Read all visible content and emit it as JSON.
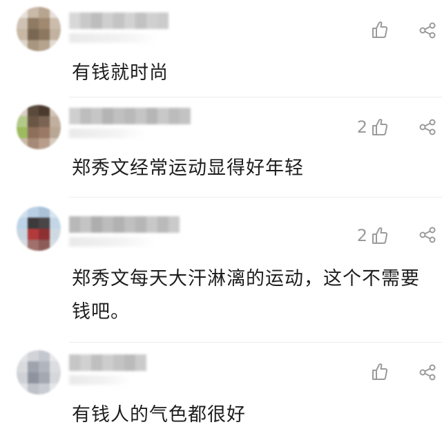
{
  "comments": [
    {
      "text": "有钱就时尚",
      "like_count": "",
      "avatar_icon": "user-avatar-blurred",
      "like_icon": "thumbs-up-icon",
      "share_icon": "share-icon"
    },
    {
      "text": "郑秀文经常运动显得好年轻",
      "like_count": "2",
      "avatar_icon": "user-avatar-blurred",
      "like_icon": "thumbs-up-icon",
      "share_icon": "share-icon"
    },
    {
      "text": "郑秀文每天大汗淋漓的运动，这个不需要钱吧。",
      "like_count": "2",
      "avatar_icon": "user-avatar-blurred",
      "like_icon": "thumbs-up-icon",
      "share_icon": "share-icon"
    },
    {
      "text": "有钱人的气色都很好",
      "like_count": "",
      "avatar_icon": "user-avatar-blurred",
      "like_icon": "thumbs-up-icon",
      "share_icon": "share-icon"
    }
  ],
  "colors": {
    "icon_gray": "#9a9a9a",
    "text": "#1d1d1d",
    "divider": "#ececec"
  }
}
